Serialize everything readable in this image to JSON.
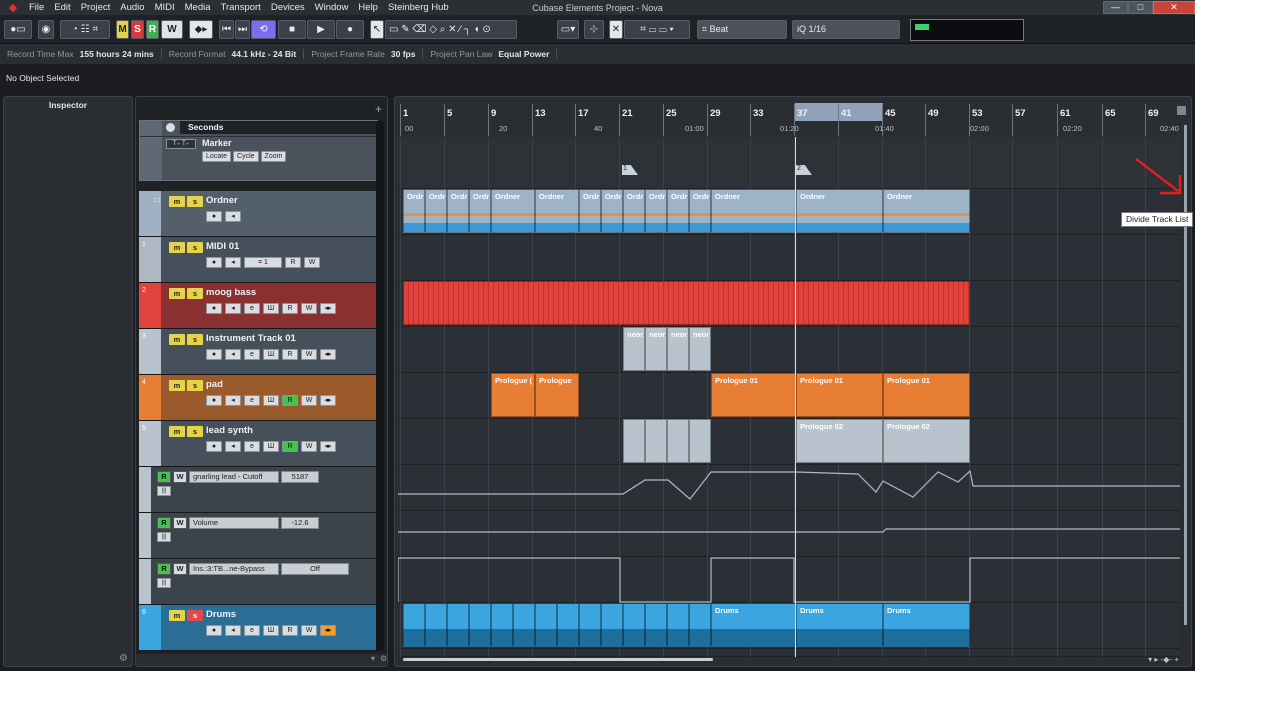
{
  "window": {
    "title": "Cubase Elements Project - Nova",
    "controls": [
      "—",
      "□",
      "✕"
    ]
  },
  "menu": [
    "File",
    "Edit",
    "Project",
    "Audio",
    "MIDI",
    "Media",
    "Transport",
    "Devices",
    "Window",
    "Help",
    "Steinberg Hub"
  ],
  "toolbar": {
    "msrw": [
      "M",
      "S",
      "R",
      "W"
    ],
    "grid_type": "Beat",
    "quantize": "1/16",
    "quantize_prefix": "iQ"
  },
  "info_line": [
    {
      "label": "Record Time Max",
      "value": "155 hours 24 mins"
    },
    {
      "label": "Record Format",
      "value": "44.1 kHz - 24 Bit"
    },
    {
      "label": "Project Frame Rate",
      "value": "30 fps"
    },
    {
      "label": "Project Pan Law",
      "value": "Equal Power"
    }
  ],
  "status": "No Object Selected",
  "inspector": {
    "title": "Inspector"
  },
  "ruler_track": {
    "name": "Seconds",
    "marker_track": "Marker",
    "marker_buttons": [
      "Locate",
      "Cycle",
      "Zoom"
    ]
  },
  "tracks": [
    {
      "id": "ordner",
      "name": "Ordner",
      "color": "#9fb1c2",
      "solo_on": false
    },
    {
      "id": "midi01",
      "number": "1",
      "name": "MIDI 01",
      "color": "#aeb8c2",
      "channel": "1",
      "solo_on": false
    },
    {
      "id": "moog",
      "number": "2",
      "name": "moog bass",
      "color": "#e0423e",
      "solo_on": false
    },
    {
      "id": "inst01",
      "number": "3",
      "name": "Instrument Track 01",
      "color": "#b9c3cd",
      "solo_on": false
    },
    {
      "id": "pad",
      "number": "4",
      "name": "pad",
      "color": "#e87d34",
      "solo_on": false
    },
    {
      "id": "lead",
      "number": "5",
      "name": "lead synth",
      "color": "#b9c3cd",
      "solo_on": false
    },
    {
      "id": "drums",
      "number": "6",
      "name": "Drums",
      "color": "#3aa5df",
      "solo_on": true
    }
  ],
  "automation": [
    {
      "name": "gnarling lead - Cutoff",
      "value": "5187"
    },
    {
      "name": "Volume",
      "value": "-12.6"
    },
    {
      "name": "Ins.:3:TB...ne-Bypass",
      "value": "Off"
    }
  ],
  "ruler": {
    "bars": [
      "1",
      "5",
      "9",
      "13",
      "17",
      "21",
      "25",
      "29",
      "33",
      "37",
      "41",
      "45",
      "49",
      "53",
      "57",
      "61",
      "65",
      "69"
    ],
    "seconds": [
      "00",
      "20",
      "40",
      "01:00",
      "01:20",
      "01:40",
      "02:00",
      "02:20",
      "02:40"
    ]
  },
  "markers": [
    "1",
    "2"
  ],
  "parts": {
    "ordner_short": "Ordr",
    "ordner_long": "Ordner",
    "inst_short": "neor",
    "pad_short": "Prologue (",
    "pad_mid": "Prologue",
    "pad_long": "Prologue 01",
    "lead_long": "Prologue 02",
    "drums_long": "Drums"
  },
  "tooltip": "Divide Track List",
  "colors": {
    "accent_yellow": "#e5d34a",
    "moog_red": "#e0423e",
    "pad_orange": "#e87d34",
    "drums_blue": "#3aa5df",
    "folder_blue": "#8eb4d6",
    "background": "#1b1d20"
  }
}
